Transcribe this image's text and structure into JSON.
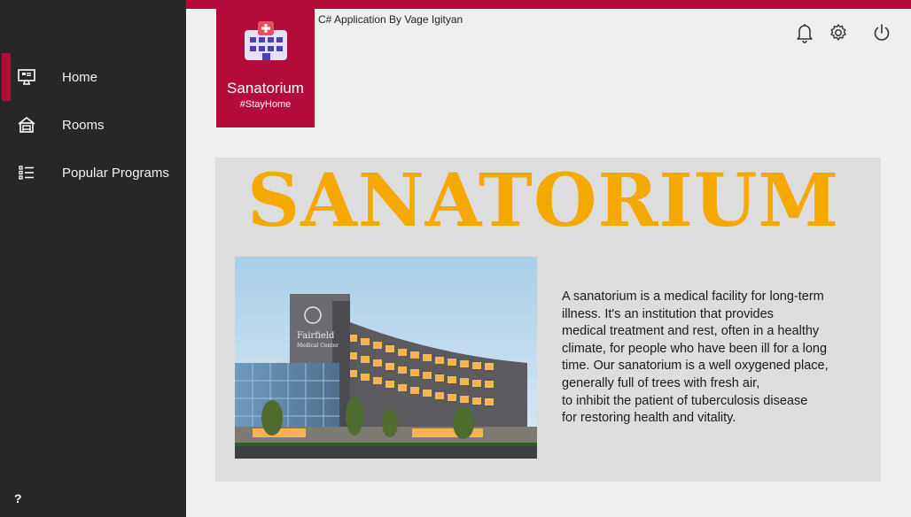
{
  "window": {
    "caption": "C# Application By Vage Igityan"
  },
  "sidebar": {
    "items": [
      {
        "label": "Home",
        "icon": "monitor-icon"
      },
      {
        "label": "Rooms",
        "icon": "house-icon"
      },
      {
        "label": "Popular Programs",
        "icon": "list-icon"
      }
    ],
    "active_index": 0,
    "help_label": "?"
  },
  "logo": {
    "name": "Sanatorium",
    "tagline": "#StayHome",
    "icon": "hospital-icon"
  },
  "toolbar": {
    "icons": [
      "bell-icon",
      "gear-icon",
      "power-icon"
    ]
  },
  "main": {
    "title": "SANATORIUM",
    "photo": {
      "sign_line1": "Fairfield",
      "sign_line2": "Medical Center"
    },
    "description": "A sanatorium is a medical facility for long-term\nillness. It's an institution that provides\nmedical treatment and rest, often in a healthy\nclimate, for people who have been ill for a long\ntime. Our sanatorium is a well oxygened place,\ngenerally full of trees with fresh air,\nto inhibit the patient of tuberculosis disease\nfor restoring health and vitality."
  },
  "colors": {
    "accent": "#b30c3a",
    "sidebar_bg": "#272727",
    "title": "#f5a800",
    "panel_bg": "#dddddd",
    "page_bg": "#efefef"
  }
}
